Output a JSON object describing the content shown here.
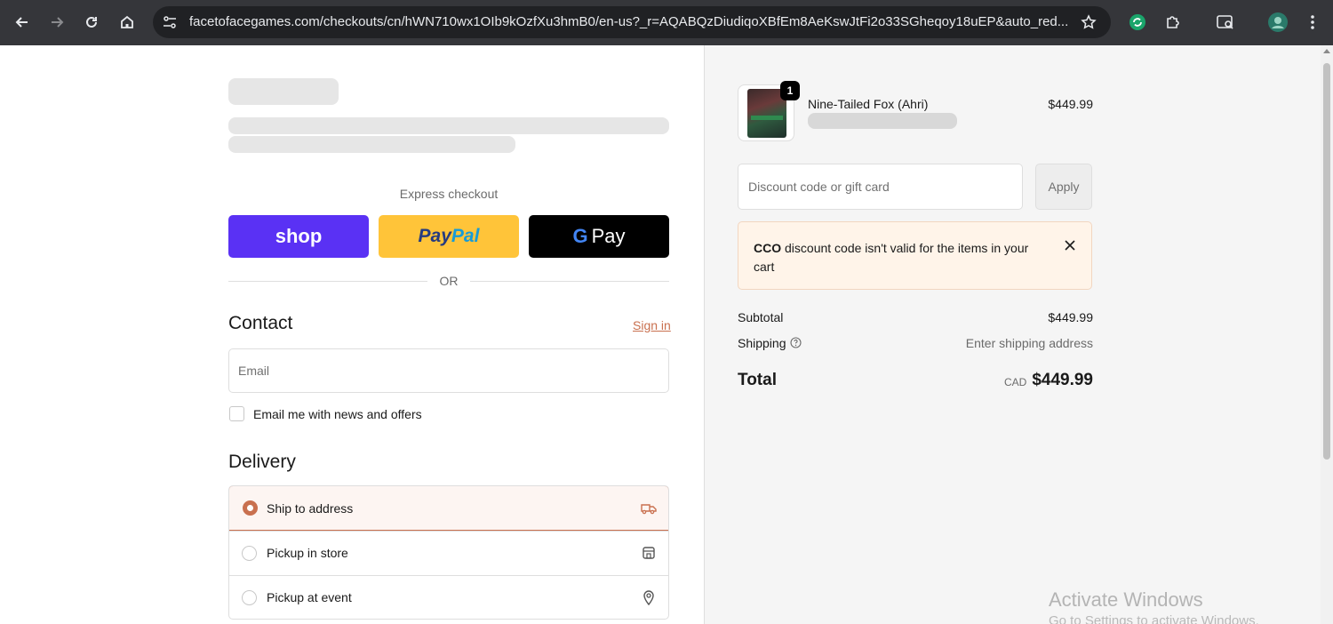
{
  "browser": {
    "url": "facetofacegames.com/checkouts/cn/hWN710wx1OIb9kOzfXu3hmB0/en-us?_r=AQABQzDiudiqoXBfEm8AeKswJtFi2o33SGheqoy18uEP&auto_red..."
  },
  "checkout": {
    "express_label": "Express checkout",
    "shop_label": "shop",
    "paypal_label_1": "Pay",
    "paypal_label_2": "Pal",
    "gpay_g": "G",
    "gpay_label": "Pay",
    "or_label": "OR",
    "contact_title": "Contact",
    "signin_label": "Sign in",
    "email_placeholder": "Email",
    "news_label": "Email me with news and offers",
    "delivery_title": "Delivery",
    "delivery_options": [
      {
        "label": "Ship to address",
        "icon": "truck-icon",
        "selected": true
      },
      {
        "label": "Pickup in store",
        "icon": "store-icon",
        "selected": false
      },
      {
        "label": "Pickup at event",
        "icon": "location-pin-icon",
        "selected": false
      }
    ]
  },
  "summary": {
    "item": {
      "name": "Nine-Tailed Fox (Ahri)",
      "price": "$449.99",
      "quantity": "1"
    },
    "discount_placeholder": "Discount code or gift card",
    "apply_label": "Apply",
    "alert": {
      "code": "CCO",
      "message": " discount code isn't valid for the items in your cart"
    },
    "subtotal_label": "Subtotal",
    "subtotal_value": "$449.99",
    "shipping_label": "Shipping",
    "shipping_value": "Enter shipping address",
    "total_label": "Total",
    "currency": "CAD",
    "total_value": "$449.99"
  },
  "watermark": {
    "line1": "Activate Windows",
    "line2": "Go to Settings to activate Windows."
  },
  "colors": {
    "accent": "#c9704f",
    "shop": "#5a31f4",
    "paypal": "#ffc439",
    "gpay": "#000000"
  }
}
